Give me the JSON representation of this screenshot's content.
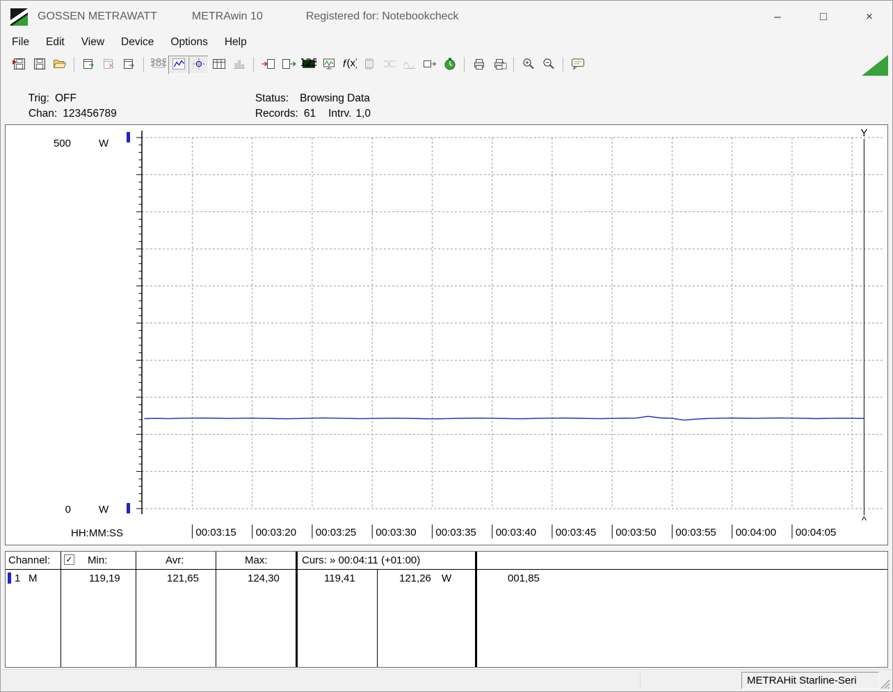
{
  "window": {
    "brand": "GOSSEN METRAWATT",
    "app": "METRAwin 10",
    "registered": "Registered for: Notebookcheck",
    "controls": {
      "minimize": "–",
      "maximize": "□",
      "close": "×"
    }
  },
  "menu": {
    "items": [
      "File",
      "Edit",
      "View",
      "Device",
      "Options",
      "Help"
    ]
  },
  "toolbar": {
    "buttons": [
      {
        "name": "file-import",
        "state": "normal"
      },
      {
        "name": "file-save",
        "state": "normal"
      },
      {
        "name": "folder-open",
        "state": "normal"
      },
      {
        "sep": true
      },
      {
        "name": "card-export",
        "state": "normal"
      },
      {
        "name": "card-delete",
        "state": "disabled"
      },
      {
        "name": "card-next",
        "state": "normal"
      },
      {
        "sep": true
      },
      {
        "name": "display-lcd",
        "state": "disabled"
      },
      {
        "name": "chart-line",
        "state": "active"
      },
      {
        "name": "chart-xy",
        "state": "active"
      },
      {
        "name": "table-view",
        "state": "normal"
      },
      {
        "name": "chart-bar",
        "state": "disabled"
      },
      {
        "sep": true
      },
      {
        "name": "transfer-in",
        "state": "normal"
      },
      {
        "name": "transfer-out",
        "state": "normal"
      },
      {
        "name": "numeric-display",
        "state": "normal"
      },
      {
        "name": "scope-display",
        "state": "normal"
      },
      {
        "name": "formula",
        "state": "normal"
      },
      {
        "name": "memory",
        "state": "disabled"
      },
      {
        "name": "channel-split",
        "state": "disabled"
      },
      {
        "name": "channel-merge",
        "state": "disabled"
      },
      {
        "name": "send-settings",
        "state": "normal"
      },
      {
        "name": "timer",
        "state": "normal"
      },
      {
        "sep": true
      },
      {
        "name": "print",
        "state": "normal"
      },
      {
        "name": "print-page",
        "state": "normal"
      },
      {
        "sep": true
      },
      {
        "name": "zoom-in",
        "state": "normal"
      },
      {
        "name": "zoom-out",
        "state": "normal"
      },
      {
        "sep": true
      },
      {
        "name": "hint",
        "state": "normal"
      }
    ],
    "grip_color": "#3aa23a"
  },
  "info": {
    "trig_label": "Trig:",
    "trig_value": "OFF",
    "chan_label": "Chan:",
    "chan_value": "123456789",
    "status_label": "Status:",
    "status_value": "Browsing Data",
    "records_label": "Records:",
    "records_value": "61",
    "intrv_label": "Intrv.",
    "intrv_value": "1,0"
  },
  "chart_data": {
    "type": "line",
    "title": "",
    "x_axis_title": "HH:MM:SS",
    "ylim": [
      0,
      500
    ],
    "y_grid_step": 50,
    "y_minor_step": 10,
    "y_axis": {
      "top": "500",
      "bottom": "0",
      "unit": "W"
    },
    "grid_color": "#9a9a9a",
    "grid_style": "dashed",
    "x_domain": [
      190.8,
      252.6
    ],
    "x_ticks": [
      {
        "t": 195,
        "label": "00:03:15"
      },
      {
        "t": 200,
        "label": "00:03:20"
      },
      {
        "t": 205,
        "label": "00:03:25"
      },
      {
        "t": 210,
        "label": "00:03:30"
      },
      {
        "t": 215,
        "label": "00:03:35"
      },
      {
        "t": 220,
        "label": "00:03:40"
      },
      {
        "t": 225,
        "label": "00:03:45"
      },
      {
        "t": 230,
        "label": "00:03:50"
      },
      {
        "t": 235,
        "label": "00:03:55"
      },
      {
        "t": 240,
        "label": "00:04:00"
      },
      {
        "t": 245,
        "label": "00:04:05"
      },
      {
        "t": 250,
        "label": ""
      }
    ],
    "cursor": {
      "t": 251,
      "label": "00:04:11",
      "top_marker": "Y",
      "bottom_marker": "^"
    },
    "series": [
      {
        "name": "Channel 1",
        "unit": "W",
        "color": "#2222cc",
        "x_start": 191,
        "x_step": 1,
        "values": [
          121.3,
          121.5,
          121.2,
          121.6,
          121.9,
          122.0,
          121.7,
          121.4,
          121.6,
          121.9,
          121.5,
          121.3,
          121.1,
          121.4,
          121.8,
          122.1,
          121.8,
          121.5,
          121.2,
          121.4,
          121.6,
          121.8,
          121.5,
          121.3,
          121.0,
          121.2,
          121.5,
          121.7,
          121.9,
          121.6,
          121.4,
          121.1,
          121.3,
          121.6,
          121.8,
          122.0,
          121.7,
          121.4,
          121.2,
          121.5,
          121.7,
          121.9,
          124.3,
          122.2,
          121.6,
          119.2,
          120.6,
          121.4,
          121.8,
          122.0,
          121.7,
          121.5,
          121.9,
          122.1,
          121.8,
          121.6,
          121.3,
          121.5,
          121.8,
          121.6,
          121.4
        ]
      }
    ]
  },
  "table": {
    "header": {
      "channel": "Channel:",
      "check_glyph": "✓",
      "min": "Min:",
      "avr": "Avr:",
      "max": "Max:",
      "curs": "Curs: » 00:04:11 (+01:00)"
    },
    "rows": [
      {
        "marker_color": "#2222cc",
        "num": "1",
        "mode": "M",
        "min": "119,19",
        "avr": "121,65",
        "max": "124,30",
        "curs1": "119,41",
        "curs2": "121,26",
        "unit": "W",
        "extra": "001,85"
      }
    ]
  },
  "statusbar": {
    "device": "METRAHit Starline-Seri"
  }
}
